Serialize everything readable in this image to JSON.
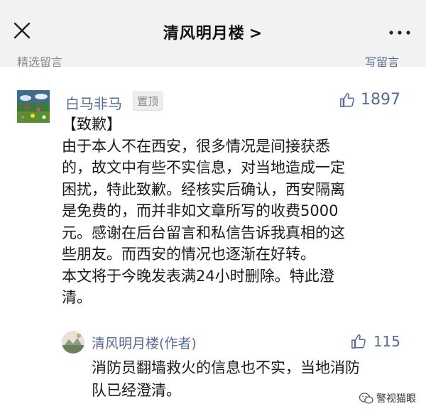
{
  "header": {
    "title": "清风明月楼",
    "chevron": ">",
    "close_icon": "close-icon",
    "more_icon": "more-dots-icon"
  },
  "section": {
    "left_label": "精选留言",
    "right_link": "写留言"
  },
  "comment": {
    "author": "白马非马",
    "pinned_label": "置顶",
    "like_count": "1897",
    "lines": [
      "【致歉】",
      "由于本人不在西安，很多情况是间接获悉",
      "的，故文中有些不实信息，对当地造成一定",
      "困扰，特此致歉。经核实后确认，西安隔离",
      "是免费的，而并非如文章所写的收费5000",
      "元。感谢在后台留言和私信告诉我真相的这",
      "些朋友。而西安的情况也逐渐在好转。",
      "本文将于今晚发表满24小时删除。特此澄",
      "清。"
    ]
  },
  "reply": {
    "author": "清风明月楼(作者)",
    "like_count": "115",
    "lines": [
      "消防员翻墙救火的信息也不实，当地消防",
      "队已经澄清。"
    ]
  },
  "watermark": {
    "text": "警视猫眼",
    "icon": "wechat-icon"
  },
  "colors": {
    "link_blue": "#576b95",
    "topbar_bg": "#f2f2f2",
    "text": "#1a1a1a"
  }
}
